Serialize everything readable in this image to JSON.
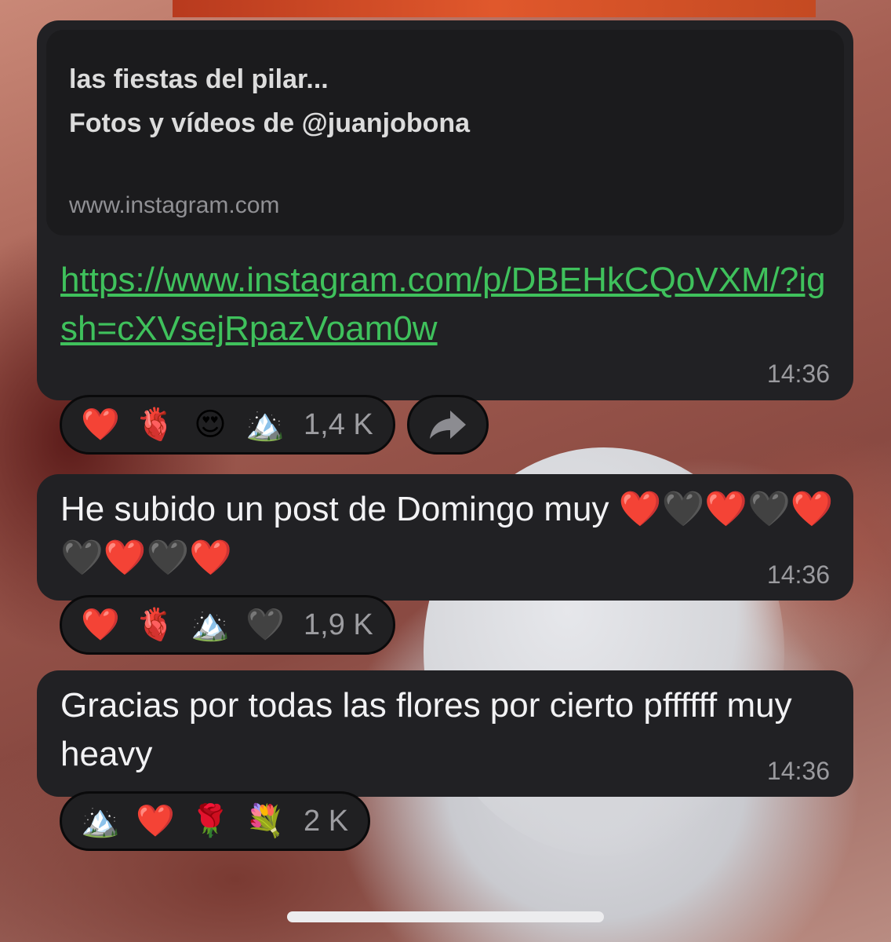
{
  "message1": {
    "preview_title": "las fiestas del pilar...",
    "preview_subtitle": "Fotos y vídeos de @juanjobona",
    "preview_domain": "www.instagram.com",
    "link": "https://www.instagram.com/p/DBEHkCQoVXM/?igsh=cXVsejRpazVoam0w",
    "time": "14:36",
    "reactions": [
      "❤️",
      "🫀",
      "😍",
      "🏔️"
    ],
    "reaction_count": "1,4 K"
  },
  "message2": {
    "text": "He subido un post de Domingo muy ❤️🖤❤️🖤❤️🖤❤️🖤❤️",
    "time": "14:36",
    "reactions": [
      "❤️",
      "🫀",
      "🏔️",
      "🖤"
    ],
    "reaction_count": "1,9 K"
  },
  "message3": {
    "text": "Gracias por todas las flores por cierto pffffff muy heavy",
    "time": "14:36",
    "reactions": [
      "🏔️",
      "❤️",
      "🌹",
      "💐"
    ],
    "reaction_count": "2 K"
  },
  "icons": {
    "share": "share-arrow-icon"
  },
  "colors": {
    "bubble": "#212124",
    "link": "#3fc15c",
    "timestamp": "#9a9a9e"
  }
}
